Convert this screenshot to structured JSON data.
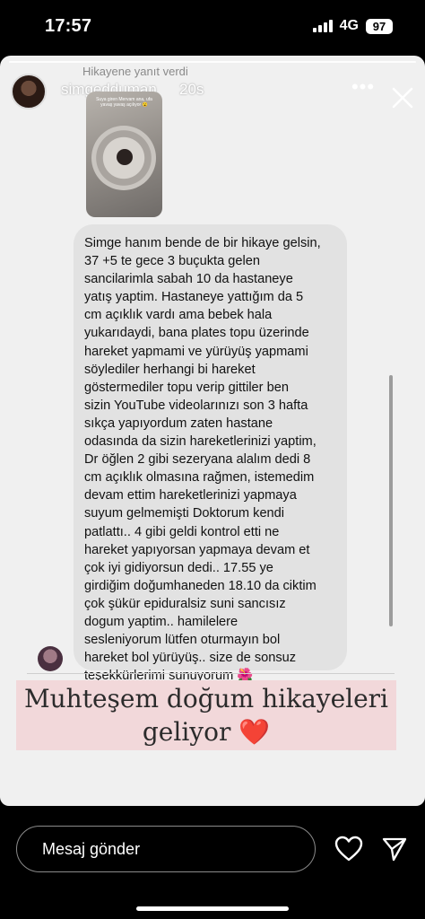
{
  "status_bar": {
    "time": "17:57",
    "network": "4G",
    "battery": "97"
  },
  "story": {
    "username": "simgedduman",
    "time_ago": "20s",
    "more_icon": "more-horizontal-icon",
    "close_icon": "close-icon"
  },
  "reply": {
    "label": "Hikayene yanıt verdi",
    "thumbnail_text": "Suya giren Mervam ana, ufa yavaş yavaş açılıyor 😮"
  },
  "message": {
    "text": "Simge hanım bende de bir hikaye gelsin,\n37 +5 te gece 3 buçukta gelen\nsancilarimla sabah 10 da hastaneye\nyatış yaptim. Hastaneye yattığım da 5\ncm açıklık vardı ama bebek hala\nyukarıdaydi, bana plates topu üzerinde\nhareket yapmami ve yürüyüş yapmami\nsöylediler herhangi bi hareket\ngöstermediler topu verip gittiler ben\nsizin YouTube videolarınızı son 3 hafta\nsıkça yapıyordum zaten hastane\nodasında da sizin hareketlerinizi yaptim,\nDr öğlen 2 gibi sezeryana alalım dedi 8\ncm açıklık olmasına rağmen, istemedim\ndevam ettim hareketlerinizi yapmaya\nsuyum gelmemişti Doktorum kendi\npatlattı.. 4 gibi geldi kontrol etti ne\nhareket yapıyorsan yapmaya devam et\nçok iyi gidiyorsun dedi.. 17.55 ye\ngirdiğim doğumhaneden 18.10 da ciktim\nçok şükür epiduralsiz suni sancısız\ndogum yaptim.. hamilelere\nsesleniyorum lütfen oturmayın bol\nhareket bol yürüyüş.. size de sonsuz\nteşekkürlerimi sunuyorum 🌺"
  },
  "banner": {
    "text": "Muhteşem doğum hikayeleri\ngeliyor ❤️"
  },
  "bottom_bar": {
    "message_placeholder": "Mesaj gönder",
    "like_icon": "heart-icon",
    "send_icon": "send-icon"
  },
  "colors": {
    "background": "#000000",
    "story_bg": "#f0f0f0",
    "bubble_bg": "#e2e2e2",
    "banner_bg": "#f2d8da"
  }
}
